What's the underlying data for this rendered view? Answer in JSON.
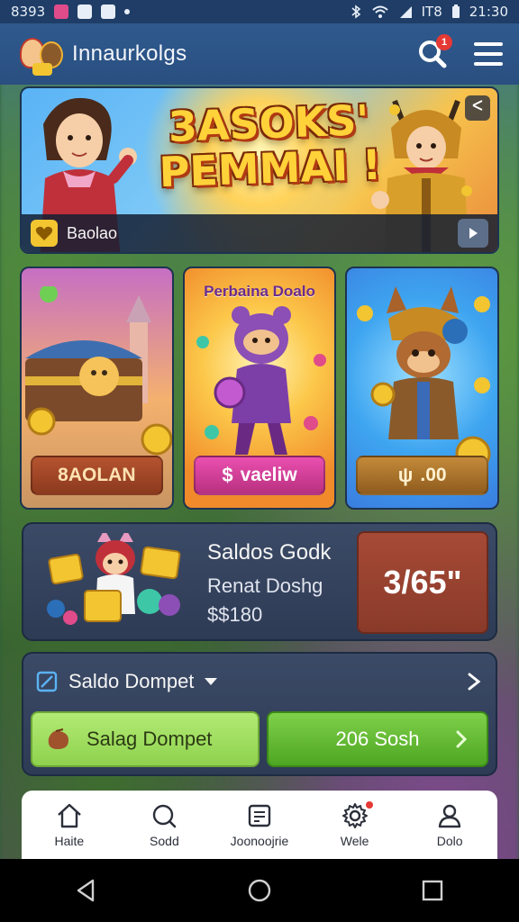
{
  "status_bar": {
    "time_left": "8393",
    "indicator": "IT8",
    "clock": "21:30"
  },
  "header": {
    "title": "Innaurkolgs",
    "notification_count": "1"
  },
  "hero": {
    "title_line1": "3ASOKS'",
    "title_line2": "PEMMAI !",
    "badge_label": "Baolao"
  },
  "cards": [
    {
      "title": "",
      "button_label": "8AOLAN"
    },
    {
      "title": "Perbaina Doalo",
      "button_prefix": "$",
      "button_label": "vaeliw"
    },
    {
      "title": "",
      "button_prefix": "ψ",
      "button_label": ".00"
    }
  ],
  "balance": {
    "title": "Saldos Godk",
    "subtitle": "Renat Doshg",
    "amount": "$$180",
    "highlight_value": "3/65\""
  },
  "wallet": {
    "title": "Saldo Dompet",
    "left_button": "Salag Dompet",
    "right_button": "206 Sosh"
  },
  "bottom_nav": [
    {
      "label": "Haite",
      "icon": "home-icon"
    },
    {
      "label": "Sodd",
      "icon": "search-icon"
    },
    {
      "label": "Joonoojrie",
      "icon": "document-icon"
    },
    {
      "label": "Wele",
      "icon": "gear-icon"
    },
    {
      "label": "Dolo",
      "icon": "user-icon"
    }
  ],
  "colors": {
    "header_bg": "#2a4f80",
    "accent_green": "#4da622",
    "accent_brown": "#8a3a2a",
    "nav_bg": "#ffffff"
  }
}
